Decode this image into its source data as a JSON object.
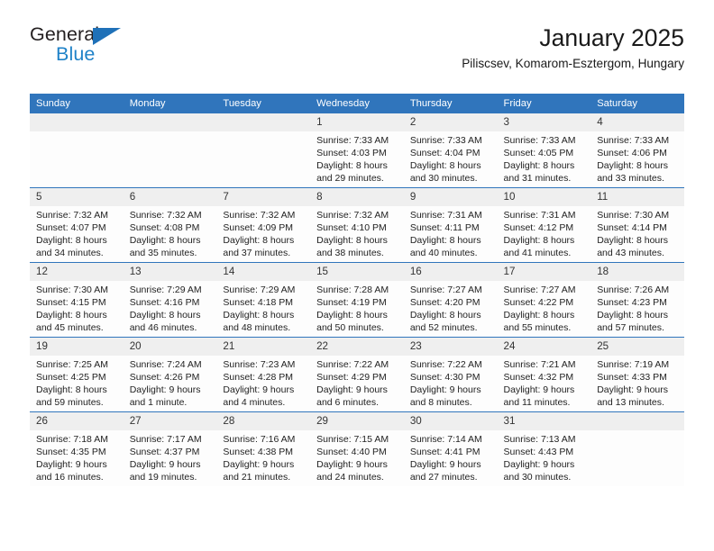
{
  "brand": {
    "line1": "General",
    "line2": "Blue",
    "triangle_icon": "brand-triangle-icon",
    "accent_color": "#1f82c8"
  },
  "header": {
    "title": "January 2025",
    "subtitle": "Piliscsev, Komarom-Esztergom, Hungary",
    "header_bg_color": "#3075bc"
  },
  "weekdays": [
    "Sunday",
    "Monday",
    "Tuesday",
    "Wednesday",
    "Thursday",
    "Friday",
    "Saturday"
  ],
  "labels": {
    "sunrise": "Sunrise:",
    "sunset": "Sunset:",
    "daylight": "Daylight:"
  },
  "weeks": [
    [
      {
        "day": "",
        "empty": true
      },
      {
        "day": "",
        "empty": true
      },
      {
        "day": "",
        "empty": true
      },
      {
        "day": "1",
        "sunrise": "Sunrise: 7:33 AM",
        "sunset": "Sunset: 4:03 PM",
        "daylight1": "Daylight: 8 hours",
        "daylight2": "and 29 minutes."
      },
      {
        "day": "2",
        "sunrise": "Sunrise: 7:33 AM",
        "sunset": "Sunset: 4:04 PM",
        "daylight1": "Daylight: 8 hours",
        "daylight2": "and 30 minutes."
      },
      {
        "day": "3",
        "sunrise": "Sunrise: 7:33 AM",
        "sunset": "Sunset: 4:05 PM",
        "daylight1": "Daylight: 8 hours",
        "daylight2": "and 31 minutes."
      },
      {
        "day": "4",
        "sunrise": "Sunrise: 7:33 AM",
        "sunset": "Sunset: 4:06 PM",
        "daylight1": "Daylight: 8 hours",
        "daylight2": "and 33 minutes."
      }
    ],
    [
      {
        "day": "5",
        "sunrise": "Sunrise: 7:32 AM",
        "sunset": "Sunset: 4:07 PM",
        "daylight1": "Daylight: 8 hours",
        "daylight2": "and 34 minutes."
      },
      {
        "day": "6",
        "sunrise": "Sunrise: 7:32 AM",
        "sunset": "Sunset: 4:08 PM",
        "daylight1": "Daylight: 8 hours",
        "daylight2": "and 35 minutes."
      },
      {
        "day": "7",
        "sunrise": "Sunrise: 7:32 AM",
        "sunset": "Sunset: 4:09 PM",
        "daylight1": "Daylight: 8 hours",
        "daylight2": "and 37 minutes."
      },
      {
        "day": "8",
        "sunrise": "Sunrise: 7:32 AM",
        "sunset": "Sunset: 4:10 PM",
        "daylight1": "Daylight: 8 hours",
        "daylight2": "and 38 minutes."
      },
      {
        "day": "9",
        "sunrise": "Sunrise: 7:31 AM",
        "sunset": "Sunset: 4:11 PM",
        "daylight1": "Daylight: 8 hours",
        "daylight2": "and 40 minutes."
      },
      {
        "day": "10",
        "sunrise": "Sunrise: 7:31 AM",
        "sunset": "Sunset: 4:12 PM",
        "daylight1": "Daylight: 8 hours",
        "daylight2": "and 41 minutes."
      },
      {
        "day": "11",
        "sunrise": "Sunrise: 7:30 AM",
        "sunset": "Sunset: 4:14 PM",
        "daylight1": "Daylight: 8 hours",
        "daylight2": "and 43 minutes."
      }
    ],
    [
      {
        "day": "12",
        "sunrise": "Sunrise: 7:30 AM",
        "sunset": "Sunset: 4:15 PM",
        "daylight1": "Daylight: 8 hours",
        "daylight2": "and 45 minutes."
      },
      {
        "day": "13",
        "sunrise": "Sunrise: 7:29 AM",
        "sunset": "Sunset: 4:16 PM",
        "daylight1": "Daylight: 8 hours",
        "daylight2": "and 46 minutes."
      },
      {
        "day": "14",
        "sunrise": "Sunrise: 7:29 AM",
        "sunset": "Sunset: 4:18 PM",
        "daylight1": "Daylight: 8 hours",
        "daylight2": "and 48 minutes."
      },
      {
        "day": "15",
        "sunrise": "Sunrise: 7:28 AM",
        "sunset": "Sunset: 4:19 PM",
        "daylight1": "Daylight: 8 hours",
        "daylight2": "and 50 minutes."
      },
      {
        "day": "16",
        "sunrise": "Sunrise: 7:27 AM",
        "sunset": "Sunset: 4:20 PM",
        "daylight1": "Daylight: 8 hours",
        "daylight2": "and 52 minutes."
      },
      {
        "day": "17",
        "sunrise": "Sunrise: 7:27 AM",
        "sunset": "Sunset: 4:22 PM",
        "daylight1": "Daylight: 8 hours",
        "daylight2": "and 55 minutes."
      },
      {
        "day": "18",
        "sunrise": "Sunrise: 7:26 AM",
        "sunset": "Sunset: 4:23 PM",
        "daylight1": "Daylight: 8 hours",
        "daylight2": "and 57 minutes."
      }
    ],
    [
      {
        "day": "19",
        "sunrise": "Sunrise: 7:25 AM",
        "sunset": "Sunset: 4:25 PM",
        "daylight1": "Daylight: 8 hours",
        "daylight2": "and 59 minutes."
      },
      {
        "day": "20",
        "sunrise": "Sunrise: 7:24 AM",
        "sunset": "Sunset: 4:26 PM",
        "daylight1": "Daylight: 9 hours",
        "daylight2": "and 1 minute."
      },
      {
        "day": "21",
        "sunrise": "Sunrise: 7:23 AM",
        "sunset": "Sunset: 4:28 PM",
        "daylight1": "Daylight: 9 hours",
        "daylight2": "and 4 minutes."
      },
      {
        "day": "22",
        "sunrise": "Sunrise: 7:22 AM",
        "sunset": "Sunset: 4:29 PM",
        "daylight1": "Daylight: 9 hours",
        "daylight2": "and 6 minutes."
      },
      {
        "day": "23",
        "sunrise": "Sunrise: 7:22 AM",
        "sunset": "Sunset: 4:30 PM",
        "daylight1": "Daylight: 9 hours",
        "daylight2": "and 8 minutes."
      },
      {
        "day": "24",
        "sunrise": "Sunrise: 7:21 AM",
        "sunset": "Sunset: 4:32 PM",
        "daylight1": "Daylight: 9 hours",
        "daylight2": "and 11 minutes."
      },
      {
        "day": "25",
        "sunrise": "Sunrise: 7:19 AM",
        "sunset": "Sunset: 4:33 PM",
        "daylight1": "Daylight: 9 hours",
        "daylight2": "and 13 minutes."
      }
    ],
    [
      {
        "day": "26",
        "sunrise": "Sunrise: 7:18 AM",
        "sunset": "Sunset: 4:35 PM",
        "daylight1": "Daylight: 9 hours",
        "daylight2": "and 16 minutes."
      },
      {
        "day": "27",
        "sunrise": "Sunrise: 7:17 AM",
        "sunset": "Sunset: 4:37 PM",
        "daylight1": "Daylight: 9 hours",
        "daylight2": "and 19 minutes."
      },
      {
        "day": "28",
        "sunrise": "Sunrise: 7:16 AM",
        "sunset": "Sunset: 4:38 PM",
        "daylight1": "Daylight: 9 hours",
        "daylight2": "and 21 minutes."
      },
      {
        "day": "29",
        "sunrise": "Sunrise: 7:15 AM",
        "sunset": "Sunset: 4:40 PM",
        "daylight1": "Daylight: 9 hours",
        "daylight2": "and 24 minutes."
      },
      {
        "day": "30",
        "sunrise": "Sunrise: 7:14 AM",
        "sunset": "Sunset: 4:41 PM",
        "daylight1": "Daylight: 9 hours",
        "daylight2": "and 27 minutes."
      },
      {
        "day": "31",
        "sunrise": "Sunrise: 7:13 AM",
        "sunset": "Sunset: 4:43 PM",
        "daylight1": "Daylight: 9 hours",
        "daylight2": "and 30 minutes."
      },
      {
        "day": "",
        "empty": true
      }
    ]
  ]
}
